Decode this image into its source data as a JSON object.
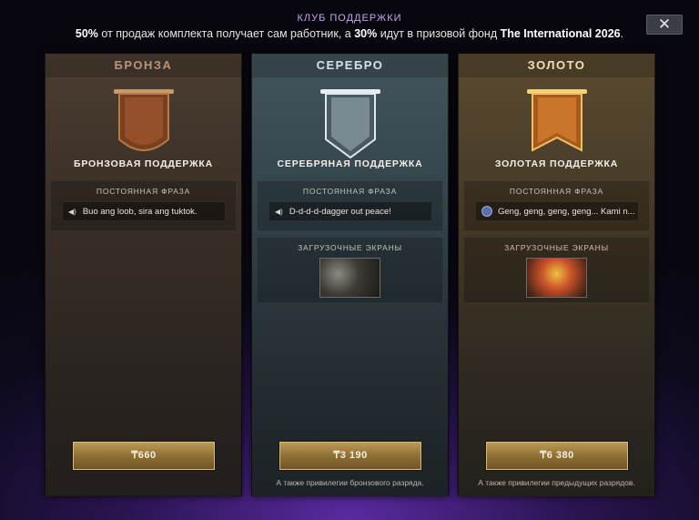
{
  "header": {
    "club_title": "КЛУБ ПОДДЕРЖКИ",
    "subtitle_pct1": "50%",
    "subtitle_mid": " от продаж комплекта получает сам работник, а ",
    "subtitle_pct2": "30%",
    "subtitle_tail": " идут в призовой фонд ",
    "subtitle_event": "The International 2026",
    "subtitle_end": ".",
    "close_label": "✕"
  },
  "tiers": [
    {
      "tier_label": "БРОНЗА",
      "support_name": "БРОНЗОВАЯ ПОДДЕРЖКА",
      "phrase_label": "ПОСТОЯННАЯ ФРАЗА",
      "phrase_text": "Buo ang loob, sira ang tuktok.",
      "price": "₸660",
      "banner_color": "#8a4a22"
    },
    {
      "tier_label": "СЕРЕБРО",
      "support_name": "СЕРЕБРЯНАЯ ПОДДЕРЖКА",
      "phrase_label": "ПОСТОЯННАЯ ФРАЗА",
      "phrase_text": "D-d-d-d-dagger out peace!",
      "screens_label": "ЗАГРУЗОЧНЫЕ ЭКРАНЫ",
      "price": "₸3 190",
      "note": "А также привилегии бронзового разряда.",
      "banner_color": "#a9b3b8"
    },
    {
      "tier_label": "ЗОЛОТО",
      "support_name": "ЗОЛОТАЯ ПОДДЕРЖКА",
      "phrase_label": "ПОСТОЯННАЯ ФРАЗА",
      "phrase_text": "Geng, geng, geng, geng... Kami n...",
      "screens_label": "ЗАГРУЗОЧНЫЕ ЭКРАНЫ",
      "price": "₸6 380",
      "note": "А также привилегии предыдущих разрядов.",
      "banner_color": "#c77a2c"
    }
  ],
  "icons": {
    "speaker": "speaker-icon",
    "close": "close-icon"
  }
}
